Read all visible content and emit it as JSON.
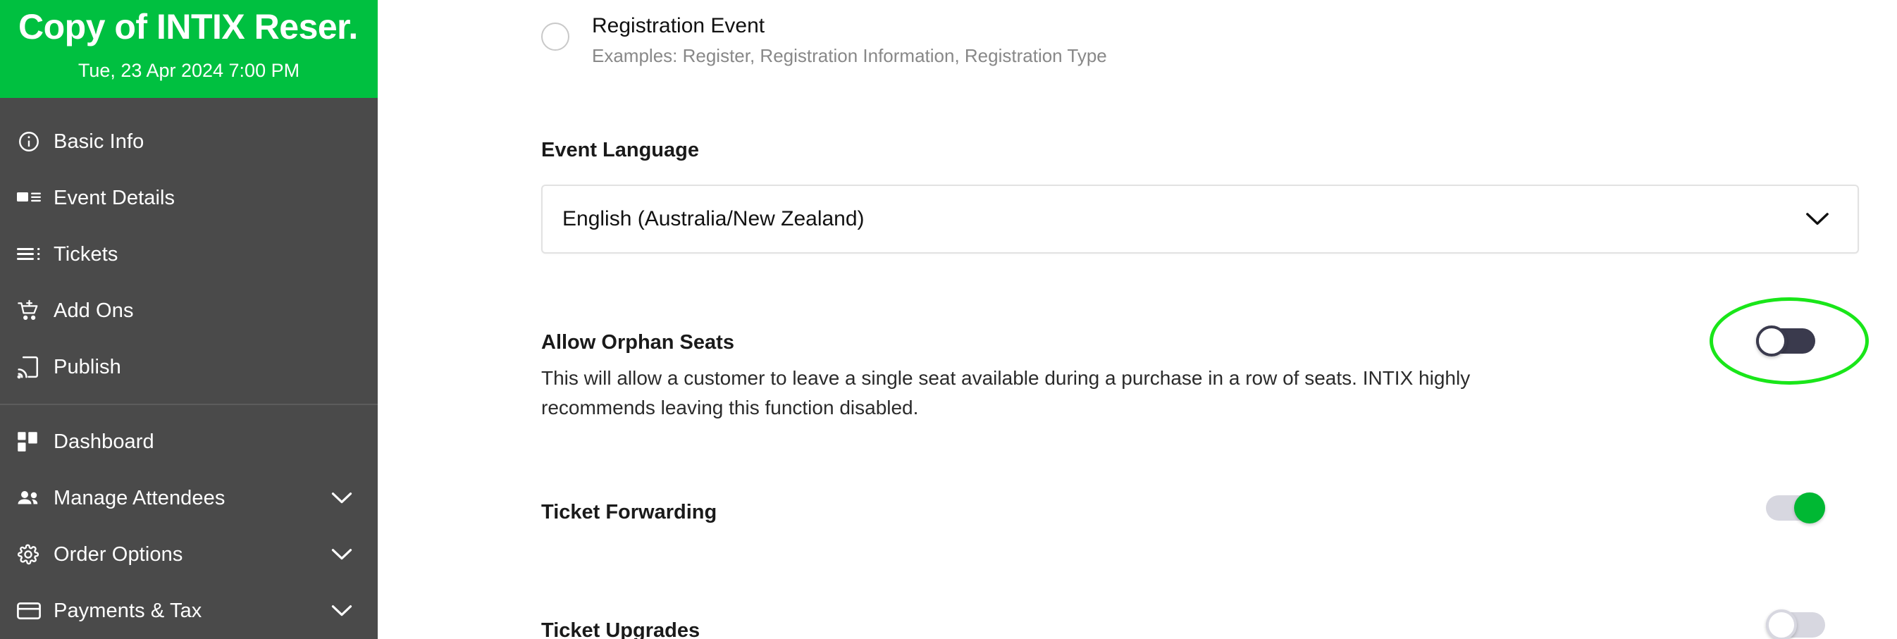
{
  "sidebar": {
    "event_title": "Copy of INTIX Reser...",
    "event_date": "Tue, 23 Apr 2024 7:00 PM",
    "brand_color": "#00c040",
    "nav_items": [
      {
        "label": "Basic Info",
        "icon": "info-circle-icon",
        "has_chevron": false
      },
      {
        "label": "Event Details",
        "icon": "image-list-icon",
        "has_chevron": false
      },
      {
        "label": "Tickets",
        "icon": "list-icon",
        "has_chevron": false
      },
      {
        "label": "Add Ons",
        "icon": "cart-plus-icon",
        "has_chevron": false
      },
      {
        "label": "Publish",
        "icon": "cast-icon",
        "has_chevron": false
      }
    ],
    "nav_items_secondary": [
      {
        "label": "Dashboard",
        "icon": "grid-icon",
        "has_chevron": false
      },
      {
        "label": "Manage Attendees",
        "icon": "people-icon",
        "has_chevron": true
      },
      {
        "label": "Order Options",
        "icon": "gear-icon",
        "has_chevron": true
      },
      {
        "label": "Payments & Tax",
        "icon": "credit-card-icon",
        "has_chevron": true
      }
    ]
  },
  "main": {
    "registration_option": {
      "title": "Registration Event",
      "description": "Examples: Register, Registration Information, Registration Type",
      "selected": false
    },
    "event_language": {
      "label": "Event Language",
      "value": "English (Australia/New Zealand)",
      "chevron_icon": "chevron-down-icon"
    },
    "settings": [
      {
        "title": "Allow Orphan Seats",
        "description": "This will allow a customer to leave a single seat available during a purchase in a row of seats. INTIX highly recommends leaving this function disabled.",
        "state": "off",
        "highlighted": true
      },
      {
        "title": "Ticket Forwarding",
        "description": "",
        "state": "on",
        "highlighted": false
      },
      {
        "title": "Ticket Upgrades",
        "description": "",
        "state": "off",
        "highlighted": false
      }
    ]
  },
  "annotation": {
    "highlight_color": "#19e619",
    "shape": "ellipse",
    "target": "Allow Orphan Seats toggle"
  }
}
